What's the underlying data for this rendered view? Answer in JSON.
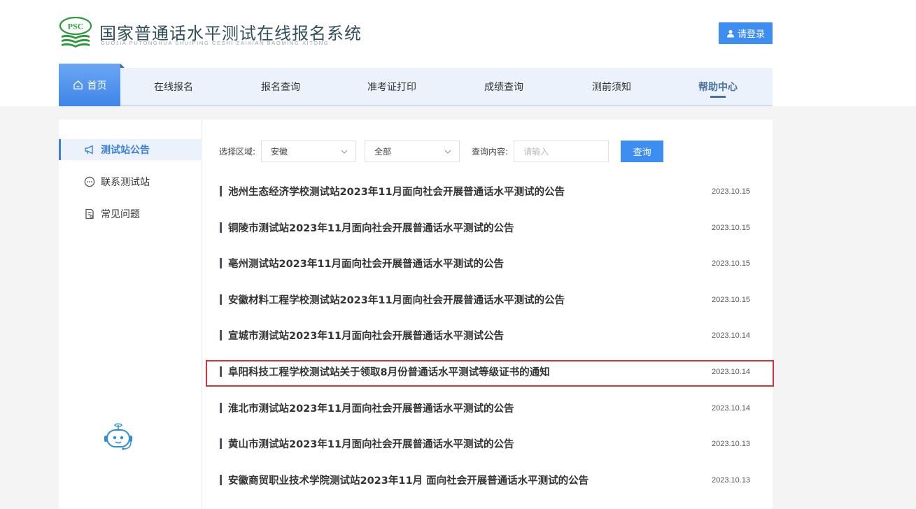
{
  "header": {
    "logo_text": "PSC",
    "title": "国家普通话水平测试在线报名系统",
    "subtitle": "GUOJIA PUTONGHUA SHUIPING CESHI ZAIXIAN BAOMING XITONG",
    "login_label": "请登录",
    "brand_color": "#2e9a3c",
    "accent_color": "#3d8ef0"
  },
  "nav": {
    "items": [
      {
        "label": "首页",
        "icon": "home-icon",
        "active": true
      },
      {
        "label": "在线报名"
      },
      {
        "label": "报名查询"
      },
      {
        "label": "准考证打印"
      },
      {
        "label": "成绩查询"
      },
      {
        "label": "测前须知"
      },
      {
        "label": "帮助中心",
        "current": true
      }
    ]
  },
  "sidebar": {
    "items": [
      {
        "label": "测试站公告",
        "icon": "megaphone-icon",
        "active": true
      },
      {
        "label": "联系测试站",
        "icon": "chat-bubble-icon"
      },
      {
        "label": "常见问题",
        "icon": "document-icon"
      }
    ],
    "assistant_icon": "robot-assistant-icon"
  },
  "filters": {
    "region_label": "选择区域:",
    "region_value": "安徽",
    "category_value": "全部",
    "content_label": "查询内容:",
    "content_placeholder": "请输入",
    "search_label": "查询"
  },
  "announcements": [
    {
      "title": "池州生态经济学校测试站2023年11月面向社会开展普通话水平测试的公告",
      "date": "2023.10.15"
    },
    {
      "title": "铜陵市测试站2023年11月面向社会开展普通话水平测试的公告",
      "date": "2023.10.15"
    },
    {
      "title": "亳州测试站2023年11月面向社会开展普通话水平测试的公告",
      "date": "2023.10.15"
    },
    {
      "title": "安徽材料工程学校测试站2023年11月面向社会开展普通话水平测试的公告",
      "date": "2023.10.15"
    },
    {
      "title": "宣城市测试站2023年11月面向社会开展普通话水平测试公告",
      "date": "2023.10.14"
    },
    {
      "title": "阜阳科技工程学校测试站关于领取8月份普通话水平测试等级证书的通知",
      "date": "2023.10.14",
      "highlighted": true
    },
    {
      "title": "淮北市测试站2023年11月面向社会开展普通话水平测试的公告",
      "date": "2023.10.14"
    },
    {
      "title": "黄山市测试站2023年11月面向社会开展普通话水平测试的公告",
      "date": "2023.10.13"
    },
    {
      "title": "安徽商贸职业技术学院测试站2023年11月 面向社会开展普通话水平测试的公告",
      "date": "2023.10.13"
    }
  ]
}
